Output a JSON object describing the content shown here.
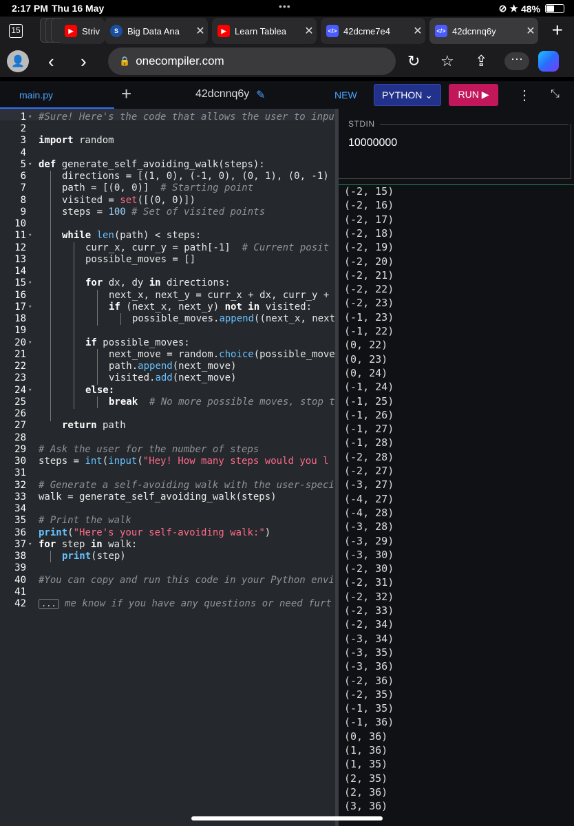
{
  "status": {
    "time": "2:17 PM",
    "date": "Thu 16 May",
    "battery": "48%",
    "battery_level": 0.48
  },
  "browser": {
    "tab_count": "15",
    "tabs": [
      {
        "label": "Striv",
        "favicon": "youtube-icon",
        "active": false
      },
      {
        "label": "Big Data Ana",
        "favicon": "globe-icon",
        "active": false
      },
      {
        "label": "Learn Tablea",
        "favicon": "youtube-icon",
        "active": false
      },
      {
        "label": "42dcme7e4",
        "favicon": "code-icon",
        "active": false
      },
      {
        "label": "42dcnnq6y",
        "favicon": "code-icon",
        "active": true
      }
    ],
    "url": "onecompiler.com"
  },
  "app": {
    "file_tab": "main.py",
    "title": "42dcnnq6y",
    "new_label": "NEW",
    "language_label": "PYTHON",
    "run_label": "RUN"
  },
  "editor": {
    "lines": [
      "1",
      "2",
      "3",
      "4",
      "5",
      "6",
      "7",
      "8",
      "9",
      "10",
      "11",
      "12",
      "13",
      "14",
      "15",
      "16",
      "17",
      "18",
      "19",
      "20",
      "21",
      "22",
      "23",
      "24",
      "25",
      "26",
      "27",
      "28",
      "29",
      "30",
      "31",
      "32",
      "33",
      "34",
      "35",
      "36",
      "37",
      "38",
      "39",
      "40",
      "41",
      "42"
    ],
    "code": {
      "l1": "#Sure! Here's the code that allows the user to inpu",
      "l3a": "import",
      "l3b": " random",
      "l5a": "def",
      "l5b": " generate_self_avoiding_walk(steps):",
      "l6": "directions = [(1, 0), (-1, 0), (0, 1), (0, -1)",
      "l7a": "path = [(0, 0)]  ",
      "l7b": "# Starting point",
      "l8a": "visited = ",
      "l8b": "set",
      "l8c": "([(0, 0)])",
      "l9a": "steps = ",
      "l9b": "100",
      "l9c": " # Set of visited points",
      "l11a": "while",
      "l11b": " len",
      "l11c": "(path) < steps:",
      "l12a": "curr_x, curr_y = path[-1]  ",
      "l12b": "# Current posit",
      "l13": "possible_moves = []",
      "l15a": "for",
      "l15b": " dx, dy ",
      "l15c": "in",
      "l15d": " directions:",
      "l16": "next_x, next_y = curr_x + dx, curr_y + ",
      "l17a": "if",
      "l17b": " (next_x, next_y) ",
      "l17c": "not in",
      "l17d": " visited:",
      "l18a": "possible_moves.",
      "l18b": "append",
      "l18c": "((next_x, next_",
      "l20a": "if",
      "l20b": " possible_moves:",
      "l21a": "next_move = random.",
      "l21b": "choice",
      "l21c": "(possible_move",
      "l22a": "path.",
      "l22b": "append",
      "l22c": "(next_move)",
      "l23a": "visited.",
      "l23b": "add",
      "l23c": "(next_move)",
      "l24": "else:",
      "l25a": "break",
      "l25b": "  # No more possible moves, stop t",
      "l27a": "return",
      "l27b": " path",
      "l29": "# Ask the user for the number of steps",
      "l30a": "steps = ",
      "l30b": "int",
      "l30c": "(",
      "l30d": "input",
      "l30e": "(",
      "l30f": "\"Hey! How many steps would you l",
      "l32": "# Generate a self-avoiding walk with the user-speci",
      "l33": "walk = generate_self_avoiding_walk(steps)",
      "l35": "# Print the walk",
      "l36a": "print",
      "l36b": "(",
      "l36c": "\"Here's your self-avoiding walk:\"",
      "l36d": ")",
      "l37a": "for",
      "l37b": " step ",
      "l37c": "in",
      "l37d": " walk:",
      "l38a": "print",
      "l38b": "(step)",
      "l40": "#You can copy and run this code in your Python envi",
      "l42a": "...",
      "l42b": " me know if you have any questions or need furt"
    }
  },
  "stdin": {
    "label": "STDIN",
    "value": "10000000"
  },
  "output": {
    "lines": [
      "(-2, 15)",
      "(-2, 16)",
      "(-2, 17)",
      "(-2, 18)",
      "(-2, 19)",
      "(-2, 20)",
      "(-2, 21)",
      "(-2, 22)",
      "(-2, 23)",
      "(-1, 23)",
      "(-1, 22)",
      "(0, 22)",
      "(0, 23)",
      "(0, 24)",
      "(-1, 24)",
      "(-1, 25)",
      "(-1, 26)",
      "(-1, 27)",
      "(-1, 28)",
      "(-2, 28)",
      "(-2, 27)",
      "(-3, 27)",
      "(-4, 27)",
      "(-4, 28)",
      "(-3, 28)",
      "(-3, 29)",
      "(-3, 30)",
      "(-2, 30)",
      "(-2, 31)",
      "(-2, 32)",
      "(-2, 33)",
      "(-2, 34)",
      "(-3, 34)",
      "(-3, 35)",
      "(-3, 36)",
      "(-2, 36)",
      "(-2, 35)",
      "(-1, 35)",
      "(-1, 36)",
      "(0, 36)",
      "(1, 36)",
      "(1, 35)",
      "(2, 35)",
      "(2, 36)",
      "(3, 36)"
    ]
  },
  "colors": {
    "run": "#c2185b",
    "language": "#22328a",
    "accent": "#4aa3ff"
  }
}
